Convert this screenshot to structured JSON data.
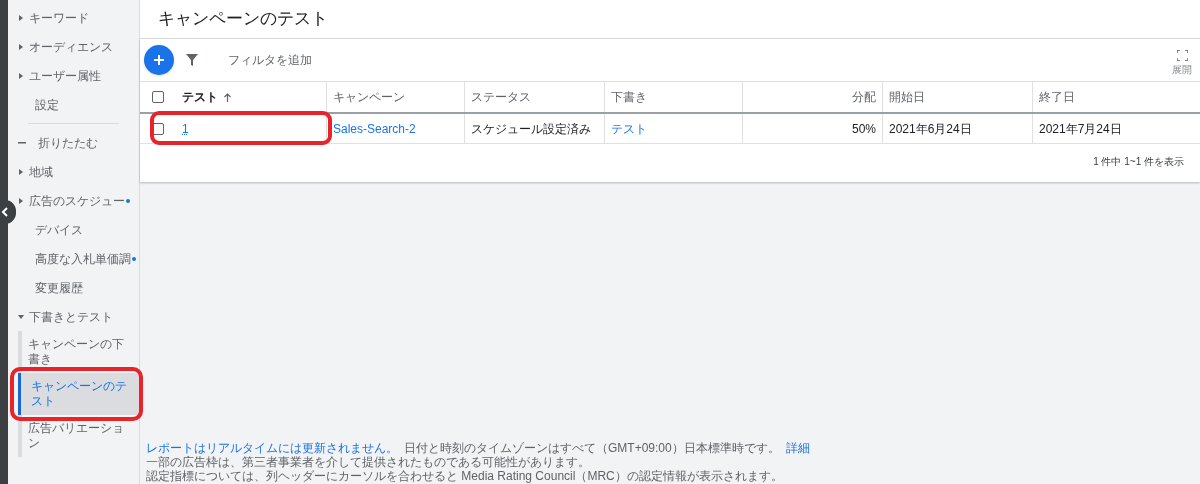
{
  "sidebar": {
    "items": [
      {
        "kind": "expandable",
        "label": "キーワード",
        "expanded": false,
        "dot": false
      },
      {
        "kind": "expandable",
        "label": "オーディエンス",
        "expanded": false,
        "dot": false
      },
      {
        "kind": "expandable",
        "label": "ユーザー属性",
        "expanded": false,
        "dot": false
      },
      {
        "kind": "link",
        "label": "設定",
        "dot": false
      },
      {
        "kind": "divider"
      },
      {
        "kind": "collapse",
        "label": "折りたたむ"
      },
      {
        "kind": "expandable",
        "label": "地域",
        "expanded": false,
        "dot": false
      },
      {
        "kind": "expandable",
        "label": "広告のスケジュー",
        "expanded": false,
        "dot": true
      },
      {
        "kind": "link",
        "label": "デバイス",
        "dot": false
      },
      {
        "kind": "link",
        "label": "高度な入札単価調",
        "dot": true
      },
      {
        "kind": "link",
        "label": "変更履歴",
        "dot": false
      },
      {
        "kind": "expandable",
        "label": "下書きとテスト",
        "expanded": true,
        "dot": false,
        "children": [
          {
            "label": "キャンペーンの下書き",
            "selected": false,
            "highlighted": false
          },
          {
            "label": "キャンペーンのテスト",
            "selected": true,
            "highlighted": true
          },
          {
            "label": "広告バリエーション",
            "selected": false,
            "highlighted": false
          }
        ]
      }
    ]
  },
  "page_title": "キャンペーンのテスト",
  "toolbar": {
    "filter_label": "フィルタを追加",
    "expand_label": "展開"
  },
  "table": {
    "columns": [
      {
        "label": "テスト",
        "sorted": true
      },
      {
        "label": "キャンペーン",
        "sorted": false
      },
      {
        "label": "ステータス",
        "sorted": false
      },
      {
        "label": "下書き",
        "sorted": false
      },
      {
        "label": "分配",
        "sorted": false
      },
      {
        "label": "開始日",
        "sorted": false
      },
      {
        "label": "終了日",
        "sorted": false
      }
    ],
    "header_checked": false,
    "rows": [
      {
        "checked": false,
        "highlighted": true,
        "cells": [
          {
            "text": "1",
            "link": true
          },
          {
            "text": "Sales-Search-2",
            "link": true
          },
          {
            "text": "スケジュール設定済み",
            "link": false
          },
          {
            "text": "テスト",
            "link": true
          },
          {
            "text": "50%",
            "link": false
          },
          {
            "text": "2021年6月24日",
            "link": false
          },
          {
            "text": "2021年7月24日",
            "link": false
          }
        ]
      }
    ],
    "pagination": "1 件中 1~1 件を表示"
  },
  "footer": {
    "lines": [
      [
        {
          "text": "レポートはリアルタイムには更新されません。",
          "link": true
        },
        {
          "text": "日付と時刻のタイムゾーンはすべて（GMT+09:00）日本標準時です。",
          "link": false
        },
        {
          "text": "詳細",
          "link": true
        }
      ],
      [
        {
          "text": "一部の広告枠は、第三者事業者を介して提供されたものである可能性があります。",
          "link": false
        }
      ],
      [
        {
          "text": "認定指標については、列ヘッダーにカーソルを合わせると Media Rating Council（MRC）の認定情報が表示されます。",
          "link": false
        }
      ]
    ]
  }
}
